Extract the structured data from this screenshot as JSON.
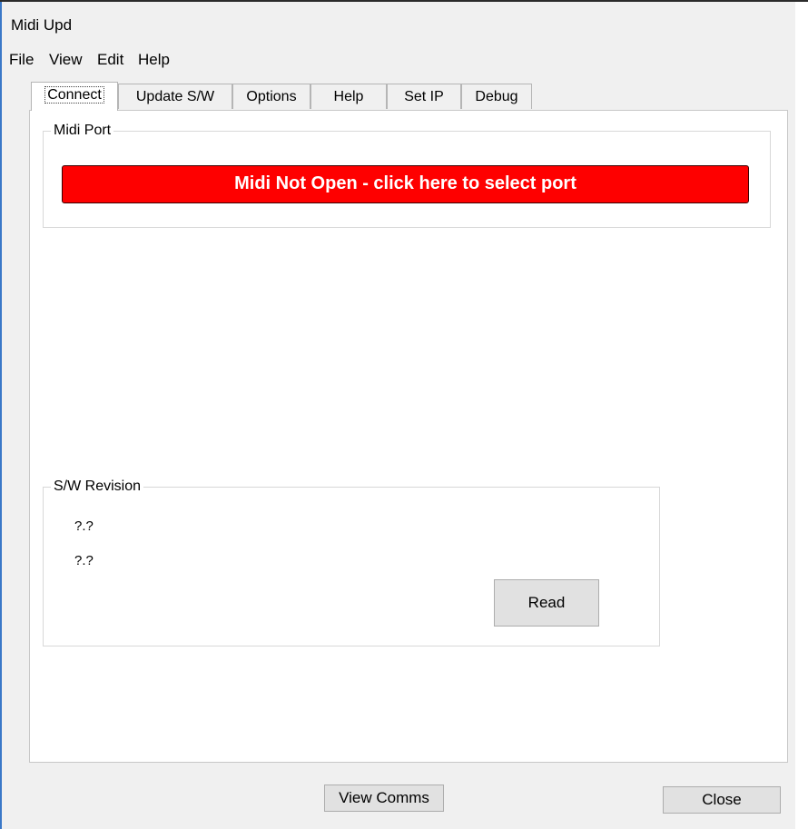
{
  "window": {
    "title": "Midi  Upd"
  },
  "menu": {
    "items": [
      "File",
      "View",
      "Edit",
      "Help"
    ]
  },
  "tabs": [
    "Connect",
    "Update S/W",
    "Options",
    "Help",
    "Set IP",
    "Debug"
  ],
  "active_tab": "Connect",
  "midi_port": {
    "group_label": "Midi Port",
    "button_label": "Midi Not Open - click here to select port",
    "button_color": "#fe0000"
  },
  "sw_revision": {
    "group_label": "S/W Revision",
    "value_1": "?.?",
    "value_2": "?.?",
    "read_label": "Read"
  },
  "footer": {
    "view_comms_label": "View Comms",
    "close_label": "Close"
  }
}
